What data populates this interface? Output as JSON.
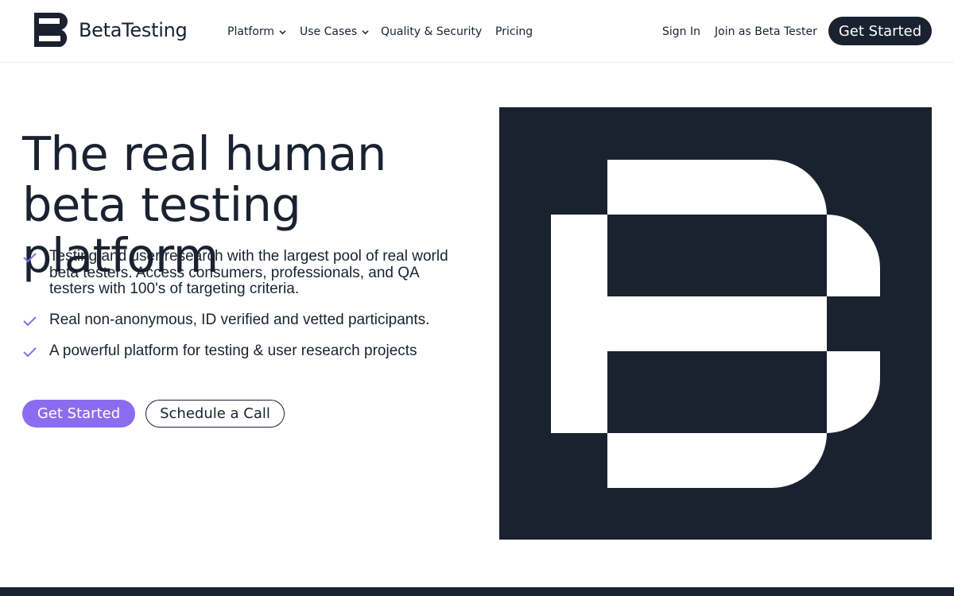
{
  "brand": {
    "name": "BetaTesting",
    "logo_icon": "betatesting-b-logo",
    "dark_color": "#1a2230",
    "accent_color": "#8b6cf0"
  },
  "nav": {
    "items": [
      {
        "label": "Platform",
        "has_dropdown": true
      },
      {
        "label": "Use Cases",
        "has_dropdown": true
      },
      {
        "label": "Quality & Security",
        "has_dropdown": false
      },
      {
        "label": "Pricing",
        "has_dropdown": false
      }
    ],
    "sign_in": "Sign In",
    "join": "Join as Beta Tester",
    "cta": "Get Started"
  },
  "hero": {
    "title": "The real human beta testing platform",
    "features": [
      "Testing and user research with the largest pool of real world beta testers. Access consumers, professionals, and QA testers with 100's of targeting criteria.",
      "Real non-anonymous, ID verified and vetted participants.",
      "A powerful platform for testing & user research projects"
    ],
    "primary_cta": "Get Started",
    "secondary_cta": "Schedule a Call",
    "illustration_icon": "large-b-logo-graphic"
  }
}
